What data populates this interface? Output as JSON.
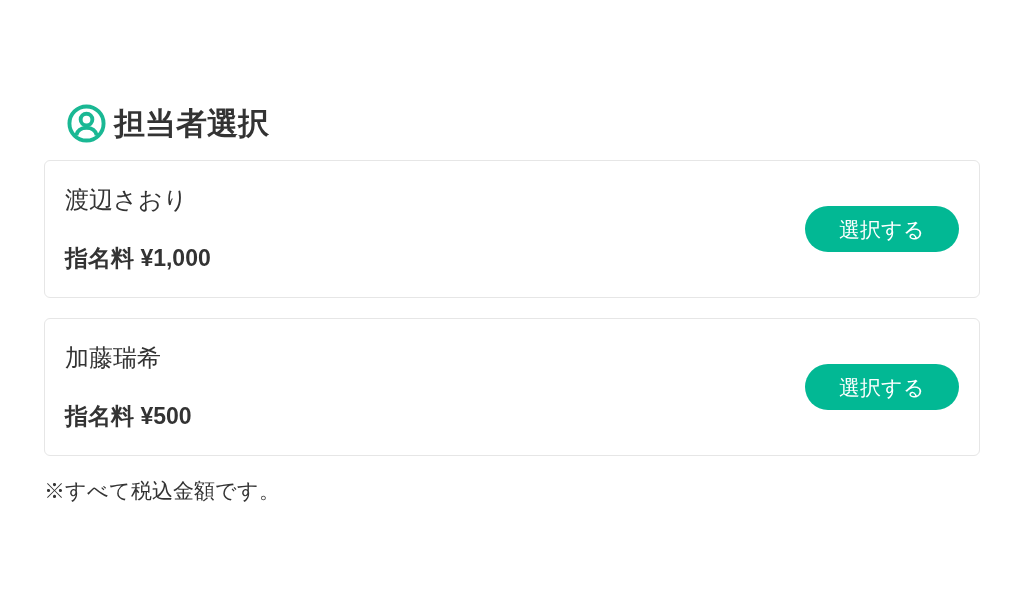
{
  "section": {
    "title": "担当者選択"
  },
  "staff": [
    {
      "name": "渡辺さおり",
      "fee": "指名料 ¥1,000",
      "button": "選択する"
    },
    {
      "name": "加藤瑞希",
      "fee": "指名料 ¥500",
      "button": "選択する"
    }
  ],
  "note": "※すべて税込金額です。"
}
